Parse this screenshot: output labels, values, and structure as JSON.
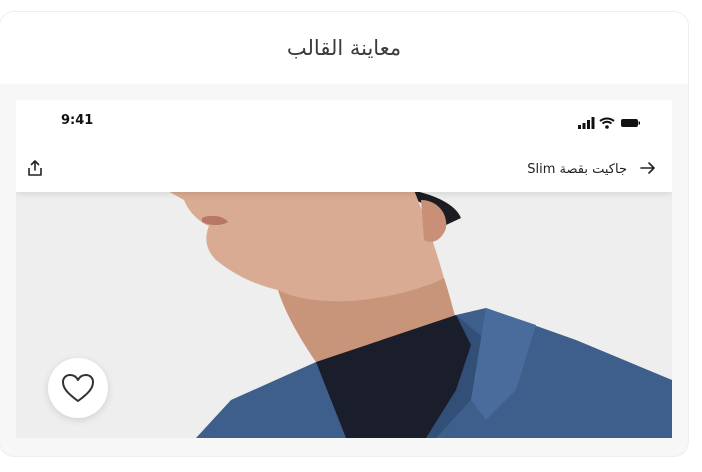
{
  "card": {
    "title": "معاينة القالب"
  },
  "status_bar": {
    "time": "9:41",
    "icons": [
      "signal-icon",
      "wifi-icon",
      "battery-icon"
    ]
  },
  "nav_bar": {
    "title": "جاكيت بقصة Slim",
    "back_icon": "arrow-right-icon",
    "share_icon": "share-icon"
  },
  "product": {
    "image": "man-in-blue-jacket-photo",
    "favorite_icon": "heart-icon"
  },
  "colors": {
    "jacket": "#3e5f8c",
    "skin": "#d9ab93",
    "background": "#eeeeee",
    "shirt": "#1a1d2a"
  }
}
